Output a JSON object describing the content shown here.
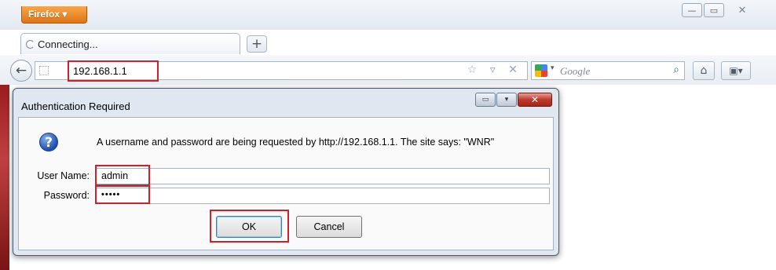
{
  "browser": {
    "app_menu_label": "Firefox ▾",
    "tab_label": "Connecting...",
    "new_tab_label": "+",
    "url": "192.168.1.1",
    "url_tools": "☆ ▿ ✕",
    "search_placeholder": "Google",
    "window_controls": [
      "—",
      "▭",
      "✕"
    ]
  },
  "dialog": {
    "title": "Authentication Required",
    "message": "A username and password are being requested by http://192.168.1.1. The site says: \"WNR\"",
    "username_label": "User Name:",
    "username_value": "admin",
    "password_label": "Password:",
    "password_value": "•••••",
    "ok_label": "OK",
    "cancel_label": "Cancel",
    "icon": "question-icon"
  },
  "colors": {
    "highlight": "#d1202a",
    "firefox_button": "#e07413",
    "dialog_frame": "#dfe7f1"
  }
}
